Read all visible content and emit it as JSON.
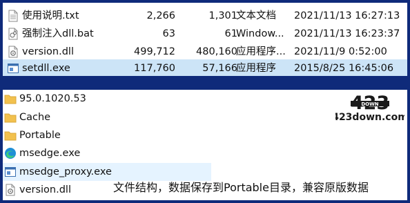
{
  "top_files": [
    {
      "icon": "text-file-icon",
      "name": "使用说明.txt",
      "size": "2,266",
      "compressed": "1,301",
      "type": "文本文档",
      "date": "2021/11/13 16:27:13"
    },
    {
      "icon": "batch-file-icon",
      "name": "强制注入dll.bat",
      "size": "63",
      "compressed": "61",
      "type": "Window...",
      "date": "2021/11/13 16:23:37"
    },
    {
      "icon": "dll-file-icon",
      "name": "version.dll",
      "size": "499,712",
      "compressed": "480,160",
      "type": "应用程序...",
      "date": "2021/11/9 0:52:00"
    },
    {
      "icon": "exe-file-icon",
      "name": "setdll.exe",
      "size": "117,760",
      "compressed": "57,166",
      "type": "应用程序",
      "date": "2015/8/25 16:45:06"
    }
  ],
  "bottom_files": [
    {
      "icon": "folder-icon",
      "name": "95.0.1020.53"
    },
    {
      "icon": "folder-icon",
      "name": "Cache"
    },
    {
      "icon": "folder-icon",
      "name": "Portable"
    },
    {
      "icon": "edge-icon",
      "name": "msedge.exe"
    },
    {
      "icon": "exe-file-icon",
      "name": "msedge_proxy.exe"
    },
    {
      "icon": "dll-file-icon",
      "name": "version.dll"
    }
  ],
  "watermark": {
    "logo_digits": "423",
    "site": "423down.com",
    "band_text": "DOWN"
  },
  "caption": "文件结构，数据保存到Portable目录，兼容原版数据",
  "colors": {
    "background": "#0f2a7a",
    "selected_row": "#cce4f7",
    "hover_row": "#e5f3ff",
    "folder": "#f2c14e",
    "edge": "#1f8fd6"
  }
}
